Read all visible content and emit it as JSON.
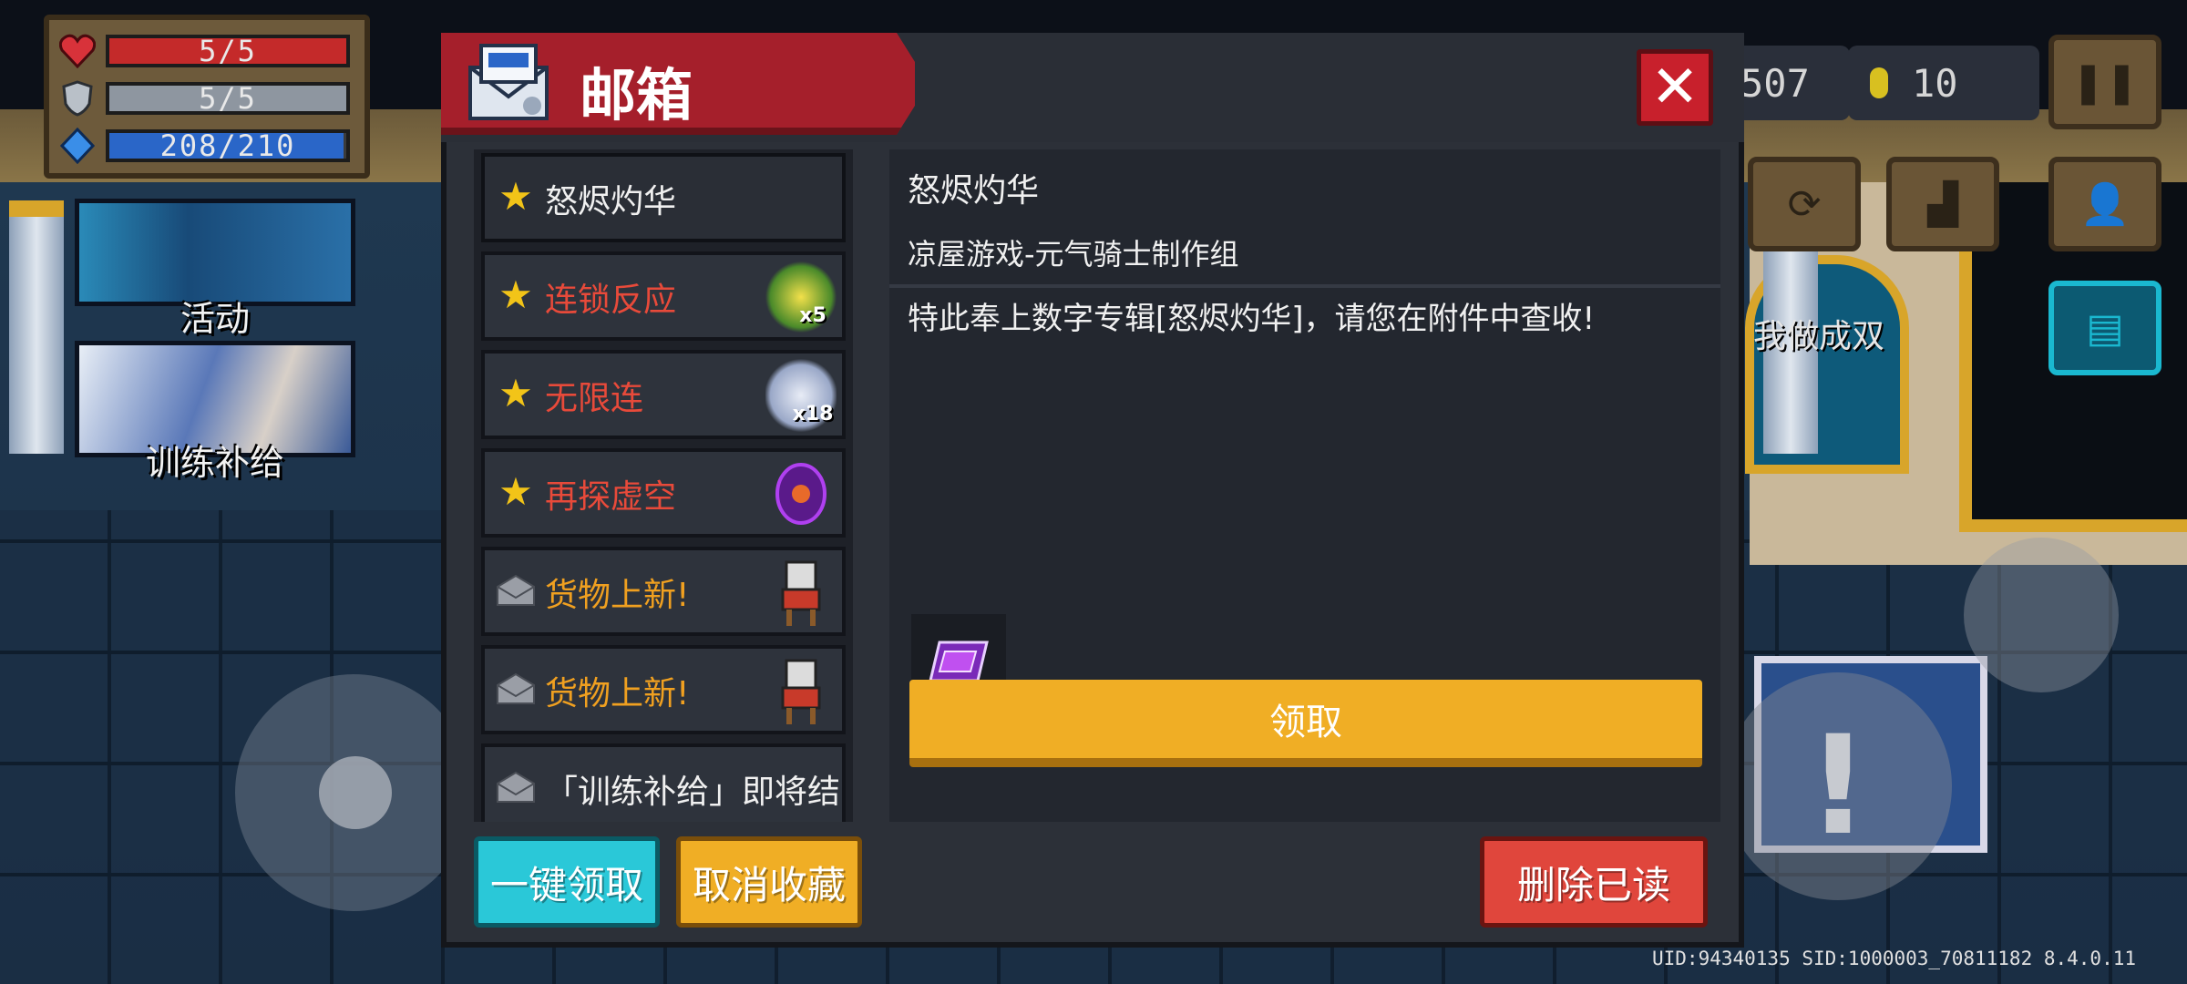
{
  "hud": {
    "health": {
      "text": "5/5",
      "fraction": 1.0,
      "color": "#c42a2a"
    },
    "armor": {
      "text": "5/5",
      "fraction": 1.0,
      "color": "#8e96a0"
    },
    "energy": {
      "text": "208/210",
      "fraction": 0.99,
      "color": "#2a66c8"
    },
    "gems_text": "507",
    "coins_text": "10",
    "side_text": "我做成双"
  },
  "banners": {
    "activity_label": "活动",
    "training_label": "训练补给"
  },
  "mail": {
    "title": "邮箱",
    "close_label": "✕",
    "items": [
      {
        "title": "怒烬灼华",
        "color": "#f0f0f0",
        "icon": "star-icon",
        "thumb": ""
      },
      {
        "title": "连锁反应",
        "color": "#e84a3a",
        "icon": "star-icon",
        "thumb": "x5"
      },
      {
        "title": "无限连",
        "color": "#e84a3a",
        "icon": "star-icon",
        "thumb": "x18"
      },
      {
        "title": "再探虚空",
        "color": "#e84a3a",
        "icon": "star-icon",
        "thumb": ""
      },
      {
        "title": "货物上新!",
        "color": "#f0a020",
        "icon": "open-envelope-icon",
        "thumb": ""
      },
      {
        "title": "货物上新!",
        "color": "#f0a020",
        "icon": "open-envelope-icon",
        "thumb": ""
      },
      {
        "title": "「训练补给」即将结",
        "color": "#f0f0f0",
        "icon": "open-envelope-icon",
        "thumb": ""
      }
    ],
    "detail": {
      "title": "怒烬灼华",
      "sender": "凉屋游戏-元气骑士制作组",
      "body": "特此奉上数字专辑[怒烬灼华]，请您在附件中查收!",
      "claim_label": "领取"
    },
    "buttons": {
      "claim_all": "一键领取",
      "unfavorite": "取消收藏",
      "delete_read": "删除已读"
    }
  },
  "version_text": "UID:94340135 SID:1000003_70811182 8.4.0.11"
}
